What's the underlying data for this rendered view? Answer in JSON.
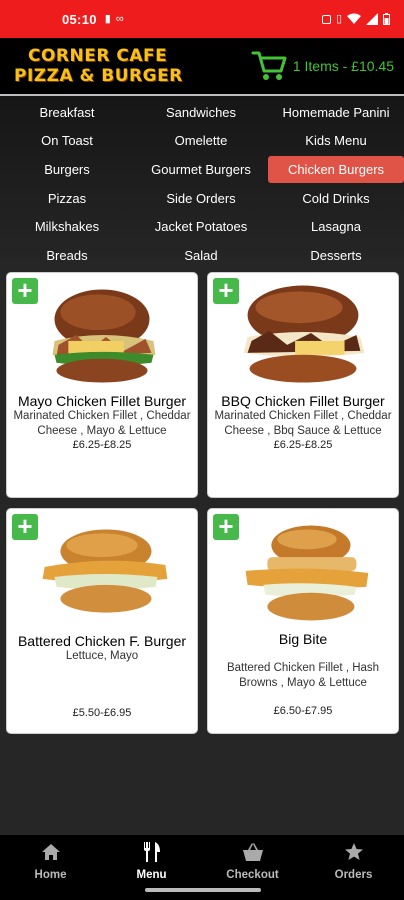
{
  "status_bar": {
    "time": "05:10"
  },
  "header": {
    "logo_line1": "CORNER CAFE",
    "logo_line2": "PIZZA & BURGER",
    "cart_text": "1 Items - £10.45"
  },
  "categories": [
    {
      "label": "Breakfast",
      "active": false
    },
    {
      "label": "Sandwiches",
      "active": false
    },
    {
      "label": "Homemade Panini",
      "active": false
    },
    {
      "label": "On Toast",
      "active": false
    },
    {
      "label": "Omelette",
      "active": false
    },
    {
      "label": "Kids Menu",
      "active": false
    },
    {
      "label": "Burgers",
      "active": false
    },
    {
      "label": "Gourmet Burgers",
      "active": false
    },
    {
      "label": "Chicken Burgers",
      "active": true
    },
    {
      "label": "Pizzas",
      "active": false
    },
    {
      "label": "Side Orders",
      "active": false
    },
    {
      "label": "Cold Drinks",
      "active": false
    },
    {
      "label": "Milkshakes",
      "active": false
    },
    {
      "label": "Jacket Potatoes",
      "active": false
    },
    {
      "label": "Lasagna",
      "active": false
    },
    {
      "label": "Breads",
      "active": false
    },
    {
      "label": "Salad",
      "active": false
    },
    {
      "label": "Desserts",
      "active": false
    }
  ],
  "products": [
    {
      "name": "Mayo Chicken Fillet Burger",
      "description": "Marinated Chicken Fillet , Cheddar Cheese , Mayo & Lettuce",
      "price": "£6.25-£8.25",
      "image": "pulled-chicken-burger"
    },
    {
      "name": "BBQ Chicken Fillet Burger",
      "description": "Marinated Chicken Fillet , Cheddar Cheese , Bbq Sauce & Lettuce",
      "price": "£6.25-£8.25",
      "image": "bbq-chicken-burger"
    },
    {
      "name": "Battered Chicken F. Burger",
      "description": "Lettuce, Mayo",
      "price": "£5.50-£6.95",
      "image": "battered-chicken-burger"
    },
    {
      "name": "Big Bite",
      "description": "Battered Chicken Fillet , Hash Browns , Mayo & Lettuce",
      "price": "£6.50-£7.95",
      "image": "big-bite-burger"
    }
  ],
  "bottom_nav": [
    {
      "label": "Home",
      "icon": "home-icon",
      "active": false
    },
    {
      "label": "Menu",
      "icon": "cutlery-icon",
      "active": true
    },
    {
      "label": "Checkout",
      "icon": "basket-icon",
      "active": false
    },
    {
      "label": "Orders",
      "icon": "star-icon",
      "active": false
    }
  ],
  "colors": {
    "status_bar": "#ee1c1c",
    "active_category": "#e05448",
    "add_button": "#46b94a",
    "cart": "#46c236",
    "logo": "#f7c11a"
  }
}
